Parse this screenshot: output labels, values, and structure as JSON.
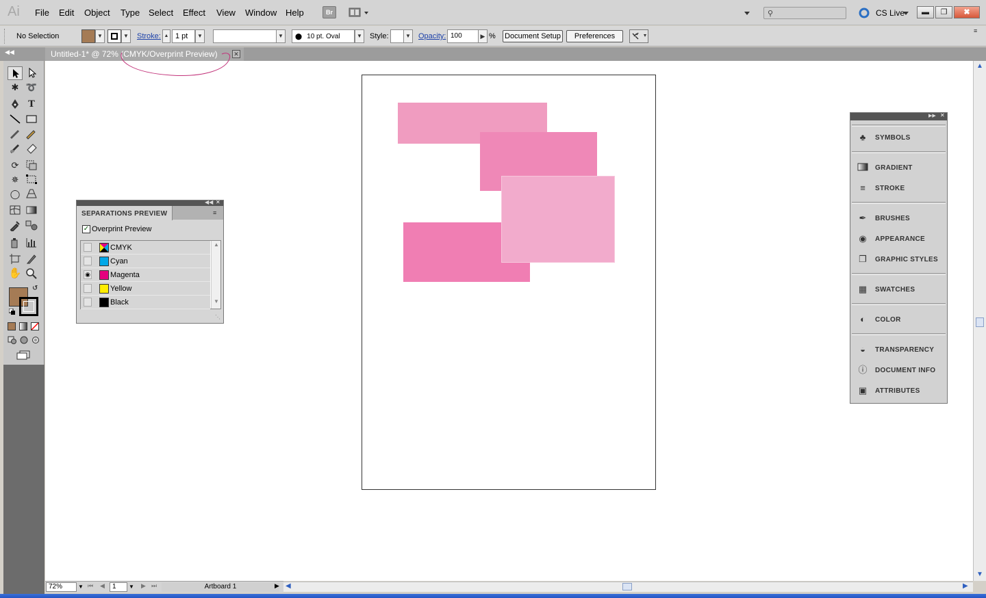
{
  "app": {
    "logo": "Ai",
    "menu": [
      "File",
      "Edit",
      "Object",
      "Type",
      "Select",
      "Effect",
      "View",
      "Window",
      "Help"
    ],
    "bridge_label": "Br",
    "cs_live": "CS Live"
  },
  "control_bar": {
    "selection_label": "No Selection",
    "stroke_label": "Stroke:",
    "stroke_value": "1 pt",
    "brush_value": "10 pt. Oval",
    "style_label": "Style:",
    "opacity_label": "Opacity:",
    "opacity_value": "100",
    "percent": "%",
    "document_setup": "Document Setup",
    "preferences": "Preferences",
    "fill_color": "#a57b55"
  },
  "document": {
    "tab_title": "Untitled-1* @ 72% (CMYK/Overprint Preview)",
    "close": "✕"
  },
  "separations_panel": {
    "title": "SEPARATIONS PREVIEW",
    "overprint_label": "Overprint Preview",
    "overprint_checked": true,
    "rows": [
      {
        "label": "CMYK",
        "color": "cmyk",
        "visible": false
      },
      {
        "label": "Cyan",
        "color": "#00a8e8",
        "visible": false
      },
      {
        "label": "Magenta",
        "color": "#e5007e",
        "visible": true
      },
      {
        "label": "Yellow",
        "color": "#ffed00",
        "visible": false
      },
      {
        "label": "Black",
        "color": "#000000",
        "visible": false
      }
    ]
  },
  "dock": {
    "items": [
      {
        "label": "SYMBOLS",
        "icon": "symbols-icon"
      },
      {
        "label": "GRADIENT",
        "icon": "gradient-icon"
      },
      {
        "label": "STROKE",
        "icon": "stroke-icon"
      },
      {
        "label": "BRUSHES",
        "icon": "brushes-icon"
      },
      {
        "label": "APPEARANCE",
        "icon": "appearance-icon"
      },
      {
        "label": "GRAPHIC STYLES",
        "icon": "graphic-styles-icon"
      },
      {
        "label": "SWATCHES",
        "icon": "swatches-icon"
      },
      {
        "label": "COLOR",
        "icon": "color-icon"
      },
      {
        "label": "TRANSPARENCY",
        "icon": "transparency-icon"
      },
      {
        "label": "DOCUMENT INFO",
        "icon": "document-info-icon"
      },
      {
        "label": "ATTRIBUTES",
        "icon": "attributes-icon"
      }
    ]
  },
  "status": {
    "zoom": "72%",
    "page": "1",
    "artboard": "Artboard 1"
  },
  "artwork": {
    "colors": [
      "#f09cc0",
      "#ef88b7",
      "#f2abcc",
      "#f07eb3"
    ]
  }
}
